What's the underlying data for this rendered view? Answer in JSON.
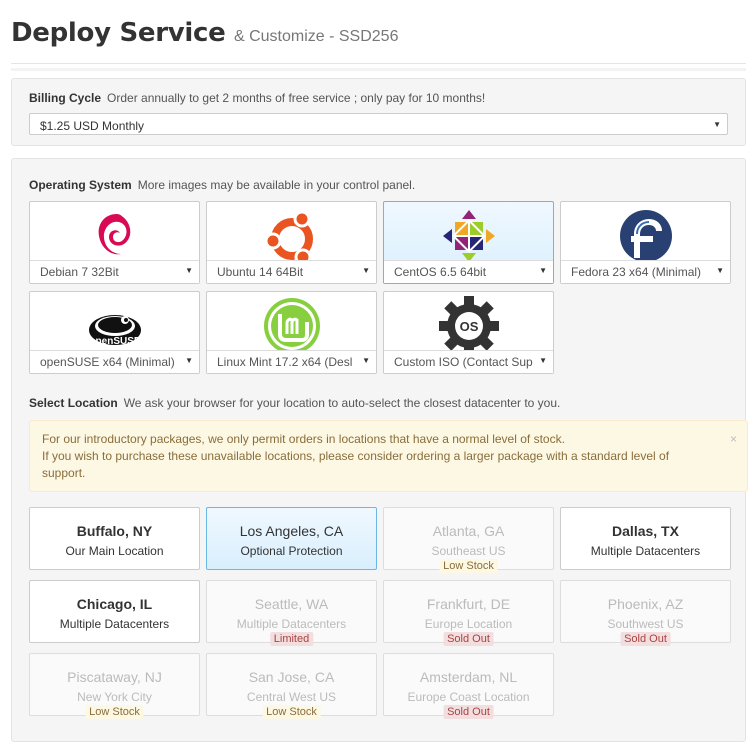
{
  "header": {
    "title": "Deploy Service",
    "subtitle": "& Customize - SSD256"
  },
  "billing": {
    "label": "Billing Cycle",
    "help": "Order annually to get 2 months of free service ; only pay for 10 months!",
    "selected": "$1.25 USD Monthly"
  },
  "os": {
    "label": "Operating System",
    "help": "More images may be available in your control panel.",
    "items": [
      {
        "name": "Debian 7 32Bit",
        "icon": "debian-logo-icon"
      },
      {
        "name": "Ubuntu 14 64Bit",
        "icon": "ubuntu-logo-icon"
      },
      {
        "name": "CentOS 6.5 64bit",
        "icon": "centos-logo-icon",
        "selected": true
      },
      {
        "name": "Fedora 23 x64 (Minimal)",
        "icon": "fedora-logo-icon"
      },
      {
        "name": "openSUSE x64 (Minimal)",
        "icon": "opensuse-logo-icon",
        "logo_text": "openSUSE"
      },
      {
        "name": "Linux Mint 17.2 x64 (Desl",
        "icon": "linux-mint-logo-icon"
      },
      {
        "name": "Custom ISO (Contact Sup",
        "icon": "custom-iso-gear-icon",
        "logo_text": "OS"
      }
    ]
  },
  "location": {
    "label": "Select Location",
    "help": "We ask your browser for your location to auto-select the closest datacenter to you.",
    "alert_line1": "For our introductory packages, we only permit orders in locations that have a normal level of stock.",
    "alert_line2": "If you wish to purchase these unavailable locations, please consider ordering a larger package with a standard level of support.",
    "alert_close": "×",
    "items": [
      {
        "name": "Buffalo, NY",
        "sub": "Our Main Location"
      },
      {
        "name": "Los Angeles, CA",
        "sub": "Optional Protection",
        "selected": true
      },
      {
        "name": "Atlanta, GA",
        "sub": "Southeast US",
        "badge": "Low Stock"
      },
      {
        "name": "Dallas, TX",
        "sub": "Multiple Datacenters"
      },
      {
        "name": "Chicago, IL",
        "sub": "Multiple Datacenters"
      },
      {
        "name": "Seattle, WA",
        "sub": "Multiple Datacenters",
        "badge": "Limited"
      },
      {
        "name": "Frankfurt, DE",
        "sub": "Europe Location",
        "badge": "Sold Out"
      },
      {
        "name": "Phoenix, AZ",
        "sub": "Southwest US",
        "badge": "Sold Out"
      },
      {
        "name": "Piscataway, NJ",
        "sub": "New York City",
        "badge": "Low Stock"
      },
      {
        "name": "San Jose, CA",
        "sub": "Central West US",
        "badge": "Low Stock"
      },
      {
        "name": "Amsterdam, NL",
        "sub": "Europe Coast Location",
        "badge": "Sold Out"
      }
    ]
  },
  "colors": {
    "selected_bg": "#d9effd",
    "selected_border": "#6bb8e6",
    "warning_bg": "#fcf8e3",
    "danger_bg": "#f2dede"
  }
}
